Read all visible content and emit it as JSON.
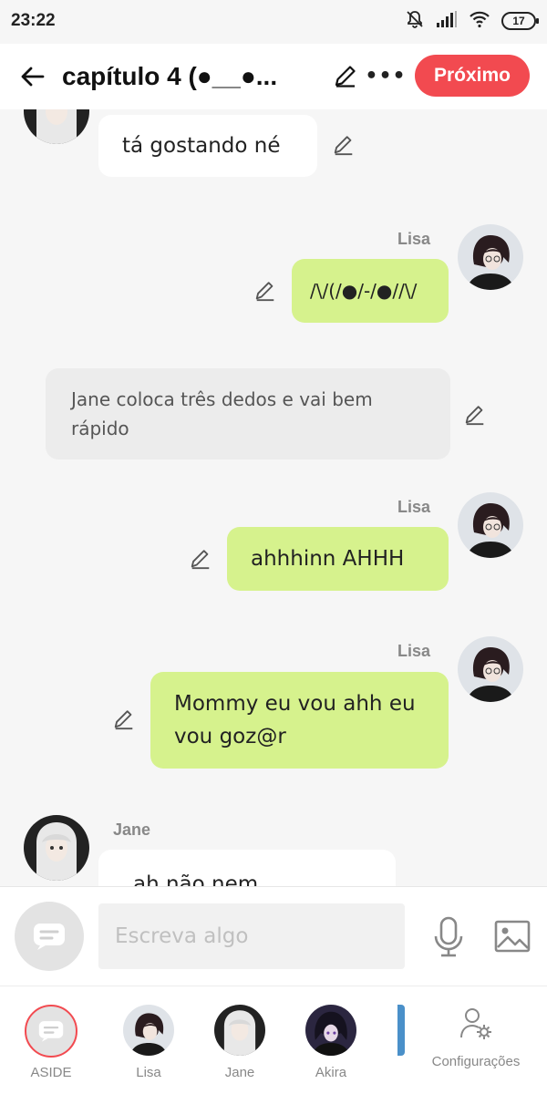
{
  "status_bar": {
    "time": "23:22",
    "battery": "17"
  },
  "header": {
    "title": "capítulo 4  (●__●...",
    "next_button": "Próximo",
    "accent_color": "#f24a50"
  },
  "messages": [
    {
      "speaker": "Jane",
      "side": "left",
      "text": "tá gostando né",
      "name_visible": false
    },
    {
      "speaker": "Lisa",
      "side": "right",
      "text": "/\\/(/●/-/●//\\/"
    },
    {
      "speaker": "narration",
      "side": "center",
      "text": "Jane coloca três dedos e vai bem rápido"
    },
    {
      "speaker": "Lisa",
      "side": "right",
      "text": "ahhhinn AHHH"
    },
    {
      "speaker": "Lisa",
      "side": "right",
      "text": "Mommy eu vou ahh eu vou goz@r"
    },
    {
      "speaker": "Jane",
      "side": "left",
      "text": "ah não nem"
    }
  ],
  "input": {
    "placeholder": "Escreva algo"
  },
  "characters": [
    {
      "name": "ASIDE",
      "icon": "chat-bubble-icon",
      "selected": true
    },
    {
      "name": "Lisa"
    },
    {
      "name": "Jane"
    },
    {
      "name": "Akira"
    }
  ],
  "settings_label": "Configurações",
  "colors": {
    "user_bubble": "#d6f28d",
    "other_bubble": "#ffffff",
    "narration_bubble": "#ececec"
  }
}
